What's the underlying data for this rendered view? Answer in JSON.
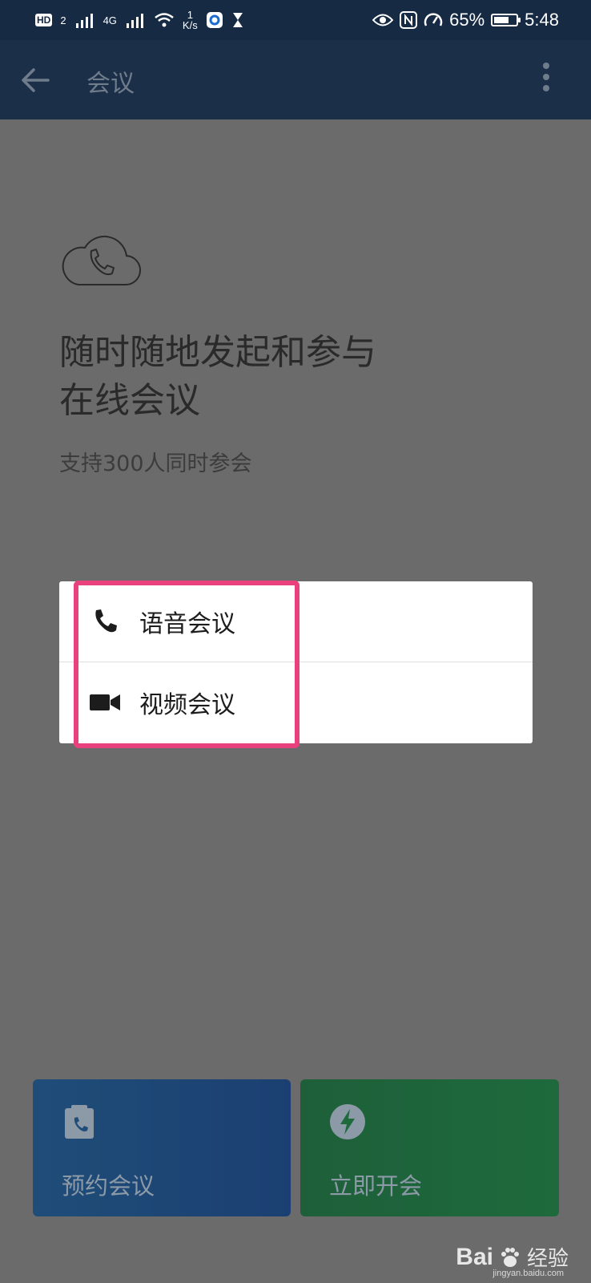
{
  "status_bar": {
    "hd_badge": "HD",
    "hd_sub": "2",
    "network": "4G",
    "speed_value": "1",
    "speed_unit": "K/s",
    "battery": "65%",
    "battery_level": 0.65,
    "time": "5:48"
  },
  "app_bar": {
    "title": "会议"
  },
  "hero": {
    "icon": "cloud-phone-icon",
    "headline_line1": "随时随地发起和参与",
    "headline_line2": "在线会议",
    "subline": "支持300人同时参会"
  },
  "menu": {
    "items": [
      {
        "icon": "phone-icon",
        "label": "语音会议"
      },
      {
        "icon": "video-camera-icon",
        "label": "视频会议"
      }
    ]
  },
  "actions": {
    "schedule": {
      "icon": "calendar-phone-icon",
      "label": "预约会议"
    },
    "instant": {
      "icon": "lightning-icon",
      "label": "立即开会"
    }
  },
  "watermark": {
    "brand": "Bai",
    "brand_suffix": "经验",
    "url": "jingyan.baidu.com"
  },
  "colors": {
    "overlay": "#6b6b6b",
    "app_bar": "#1c2f48",
    "highlight": "#e8417d",
    "schedule_card": "#1f4d78",
    "instant_card": "#1e6a3c"
  }
}
